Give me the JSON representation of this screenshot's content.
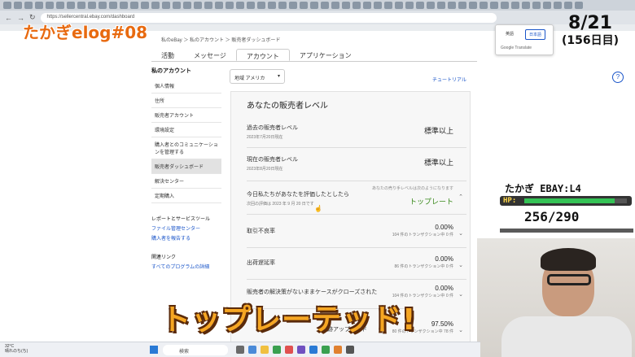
{
  "browser": {
    "url": "https://sellercentral.ebay.com/dashboard",
    "back": "←",
    "forward": "→",
    "reload": "↻"
  },
  "overlay": {
    "title": "たかぎelog#08",
    "date": "8/21",
    "day": "(156日目)",
    "banner": "トップレーテッド!"
  },
  "translate_popup": {
    "lang1": "英語",
    "lang2": "日本語",
    "brand": "Google Translate"
  },
  "breadcrumb": "私のeBay ＞ 私のアカウント ＞ 販売者ダッシュボード",
  "tabs": [
    "活動",
    "メッセージ",
    "アカウント",
    "アプリケーション"
  ],
  "sidebar": {
    "heading": "私のアカウント",
    "items": [
      "個人情報",
      "住所",
      "販売者アカウント",
      "環境設定",
      "購入者とのコミュニケーションを管理する",
      "販売者ダッシュボード",
      "解決センター",
      "定期購入"
    ],
    "reports_heading": "レポートとサービスツール",
    "reports_links": [
      "ファイル管理センター",
      "購入者を報告する"
    ],
    "related_heading": "関連リンク",
    "related_links": [
      "すべてのプログラムの詳細"
    ]
  },
  "region_select": "地域 アメリカ",
  "tutorial_link": "チュートリアル",
  "help_icon": "?",
  "seller_level": {
    "title": "あなたの販売者レベル",
    "past_label": "過去の販売者レベル",
    "past_date": "2023年7月20日現在",
    "past_value": "標準以上",
    "current_label": "現在の販売者レベル",
    "current_date": "2023年8月20日現在",
    "current_value": "標準以上",
    "eval_label": "今日私たちがあなたを評価したとしたら",
    "eval_date": "次回の評価は 2023 年 9 月 20 日です",
    "eval_hint": "あなたの売り手レベルは次のようになります",
    "eval_value": "トップレート"
  },
  "metrics": [
    {
      "label": "取引不良率",
      "value": "0.00%",
      "sub": "104 件のトランザクション中 0 件"
    },
    {
      "label": "出荷遅延率",
      "value": "0.00%",
      "sub": "86 件のトランザクション中 0 件"
    },
    {
      "label": "販売者の解決策がないままケースがクローズされた",
      "value": "0.00%",
      "sub": "104 件のトランザクション中 0 件"
    },
    {
      "label": "追跡アップロード",
      "value": "97.50%",
      "sub": "80 件のトランザクション中 78 件"
    }
  ],
  "hud": {
    "name": "たかぎ",
    "tag": "EBAY:L4",
    "hp_label": "HP:",
    "hp_value": "256/290",
    "hp_ratio": 0.883
  },
  "taskbar": {
    "weather_temp": "32°C",
    "weather_text": "晴れのち(ち)",
    "search": "検索"
  },
  "colors": {
    "accent_orange": "#e86a10",
    "link_blue": "#1a55c9",
    "top_rated_green": "#3a8a1c",
    "hp_green": "#34c255"
  }
}
